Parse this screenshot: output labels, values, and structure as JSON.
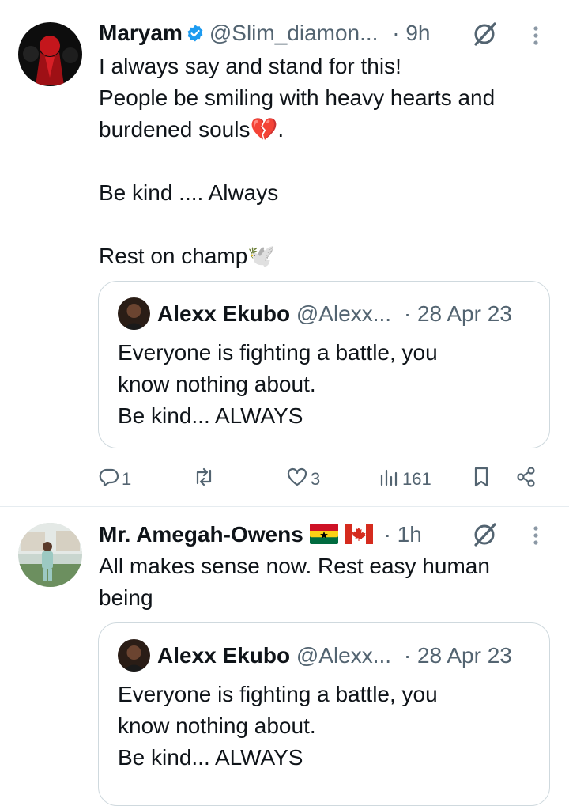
{
  "colors": {
    "accent": "#1d9bf0",
    "muted": "#536471",
    "text": "#0f1419",
    "border": "#cfd9de"
  },
  "tweets": [
    {
      "name": "Maryam",
      "verified": true,
      "handle": "@Slim_diamon...",
      "time": "· 9h",
      "lines": [
        "I always say and stand for this!",
        "People be smiling with heavy hearts and",
        "burdened souls💔.",
        "",
        "Be kind .... Always",
        "",
        "Rest on champ🕊️"
      ],
      "quote": {
        "name": "Alexx Ekubo",
        "handle": "@Alexx...",
        "time": "· 28 Apr 23",
        "lines": [
          "Everyone is fighting a battle, you",
          "know nothing about.",
          "Be kind...  ALWAYS"
        ]
      },
      "actions": {
        "replies": "1",
        "retweets": "",
        "likes": "3",
        "views": "161"
      }
    },
    {
      "name": "Mr. Amegah-Owens",
      "flags": [
        "ghana-flag-icon",
        "canada-flag-icon"
      ],
      "time": "· 1h",
      "lines": [
        "All makes sense now. Rest easy human",
        "being"
      ],
      "quote": {
        "name": "Alexx Ekubo",
        "handle": "@Alexx...",
        "time": "· 28 Apr 23",
        "lines": [
          "Everyone is fighting a battle, you",
          "know nothing about.",
          "Be kind...  ALWAYS"
        ]
      }
    }
  ]
}
